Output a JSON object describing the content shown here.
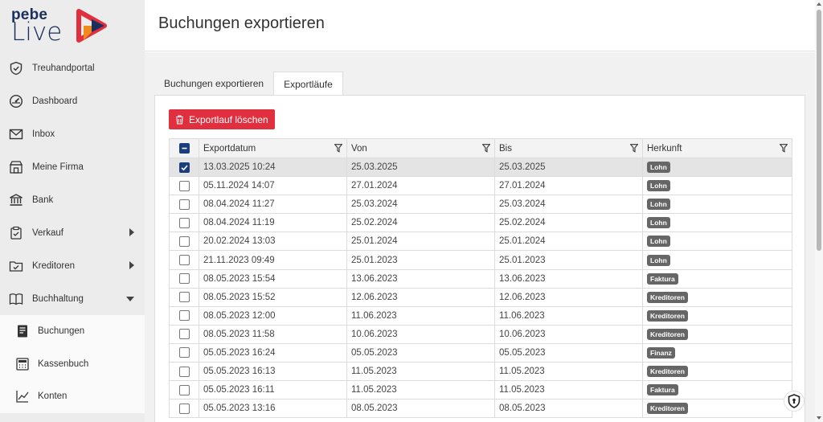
{
  "brand": {
    "pebe": "pebe",
    "live": "Live"
  },
  "sidebar": {
    "items": [
      {
        "label": "Treuhandportal",
        "icon": "shield-icon"
      },
      {
        "label": "Dashboard",
        "icon": "gauge-icon"
      },
      {
        "label": "Inbox",
        "icon": "envelope-icon"
      },
      {
        "label": "Meine Firma",
        "icon": "store-icon"
      },
      {
        "label": "Bank",
        "icon": "bank-icon"
      },
      {
        "label": "Verkauf",
        "icon": "clipboard-icon"
      },
      {
        "label": "Kreditoren",
        "icon": "folder-icon"
      },
      {
        "label": "Buchhaltung",
        "icon": "book-icon"
      }
    ],
    "subitems": [
      {
        "label": "Buchungen",
        "icon": "document-icon"
      },
      {
        "label": "Kassenbuch",
        "icon": "calculator-icon"
      },
      {
        "label": "Konten",
        "icon": "line-chart-icon"
      }
    ]
  },
  "header": {
    "title": "Buchungen exportieren"
  },
  "tabs": [
    {
      "label": "Buchungen exportieren"
    },
    {
      "label": "Exportläufe"
    }
  ],
  "toolbar": {
    "delete_label": "Exportlauf löschen"
  },
  "table": {
    "columns": [
      "Exportdatum",
      "Von",
      "Bis",
      "Herkunft"
    ],
    "rows": [
      {
        "date": "13.03.2025 10:24",
        "von": "25.03.2025",
        "bis": "25.03.2025",
        "herkunft": "Lohn",
        "checked": true
      },
      {
        "date": "05.11.2024 14:07",
        "von": "27.01.2024",
        "bis": "27.01.2024",
        "herkunft": "Lohn",
        "checked": false
      },
      {
        "date": "08.04.2024 11:27",
        "von": "25.03.2024",
        "bis": "25.03.2024",
        "herkunft": "Lohn",
        "checked": false
      },
      {
        "date": "08.04.2024 11:19",
        "von": "25.02.2024",
        "bis": "25.02.2024",
        "herkunft": "Lohn",
        "checked": false
      },
      {
        "date": "20.02.2024 13:03",
        "von": "25.01.2024",
        "bis": "25.01.2024",
        "herkunft": "Lohn",
        "checked": false
      },
      {
        "date": "21.11.2023 09:49",
        "von": "25.01.2023",
        "bis": "25.01.2023",
        "herkunft": "Lohn",
        "checked": false
      },
      {
        "date": "08.05.2023 15:54",
        "von": "13.06.2023",
        "bis": "13.06.2023",
        "herkunft": "Faktura",
        "checked": false
      },
      {
        "date": "08.05.2023 15:52",
        "von": "12.06.2023",
        "bis": "12.06.2023",
        "herkunft": "Kreditoren",
        "checked": false
      },
      {
        "date": "08.05.2023 12:00",
        "von": "11.06.2023",
        "bis": "11.06.2023",
        "herkunft": "Kreditoren",
        "checked": false
      },
      {
        "date": "08.05.2023 11:58",
        "von": "10.06.2023",
        "bis": "10.06.2023",
        "herkunft": "Kreditoren",
        "checked": false
      },
      {
        "date": "05.05.2023 16:24",
        "von": "05.05.2023",
        "bis": "05.05.2023",
        "herkunft": "Finanz",
        "checked": false
      },
      {
        "date": "05.05.2023 16:13",
        "von": "11.05.2023",
        "bis": "11.05.2023",
        "herkunft": "Kreditoren",
        "checked": false
      },
      {
        "date": "05.05.2023 16:11",
        "von": "11.05.2023",
        "bis": "11.05.2023",
        "herkunft": "Faktura",
        "checked": false
      },
      {
        "date": "05.05.2023 13:16",
        "von": "08.05.2023",
        "bis": "08.05.2023",
        "herkunft": "Kreditoren",
        "checked": false
      }
    ]
  },
  "colors": {
    "brand_navy": "#1a2f5c",
    "brand_red": "#e0303f",
    "brand_orange": "#f08a1c",
    "checkbox_blue": "#1a3d7c"
  }
}
